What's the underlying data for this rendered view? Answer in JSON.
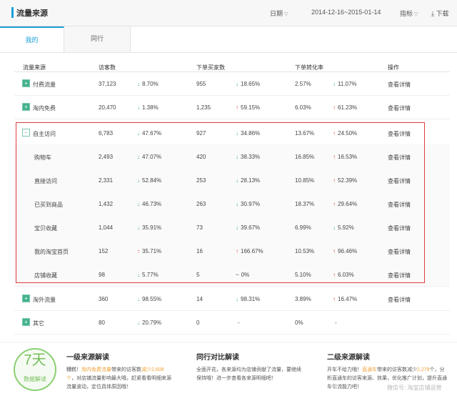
{
  "header": {
    "title": "流量来源",
    "date_label": "日期",
    "date_range": "2014-12-16~2015-01-14",
    "metric_label": "指标",
    "download_label": "下载"
  },
  "tabs": [
    {
      "label": "我的"
    },
    {
      "label": "同行"
    }
  ],
  "table": {
    "columns": [
      "流量来源",
      "访客数",
      "下单买家数",
      "下单转化率",
      "操作"
    ],
    "rows": [
      {
        "name": "付费流量",
        "visitors": "37,123",
        "visitors_change": "8.70%",
        "visitors_dir": "down",
        "buyers": "955",
        "buyers_change": "18.65%",
        "buyers_dir": "down",
        "rate": "2.57%",
        "rate_change": "11.07%",
        "rate_dir": "down",
        "action": "查看详情"
      },
      {
        "name": "淘内免费",
        "visitors": "20,470",
        "visitors_change": "1.38%",
        "visitors_dir": "down",
        "buyers": "1,235",
        "buyers_change": "59.15%",
        "buyers_dir": "up",
        "rate": "6.03%",
        "rate_change": "61.23%",
        "rate_dir": "up",
        "action": "查看详情"
      },
      {
        "name": "自主访问",
        "visitors": "6,783",
        "visitors_change": "47.67%",
        "visitors_dir": "down",
        "buyers": "927",
        "buyers_change": "34.86%",
        "buyers_dir": "down",
        "rate": "13.67%",
        "rate_change": "24.50%",
        "rate_dir": "up",
        "action": "查看详情"
      },
      {
        "name": "购物车",
        "visitors": "2,493",
        "visitors_change": "47.07%",
        "visitors_dir": "down",
        "buyers": "420",
        "buyers_change": "38.33%",
        "buyers_dir": "down",
        "rate": "16.85%",
        "rate_change": "16.53%",
        "rate_dir": "up",
        "action": "查看详情"
      },
      {
        "name": "直接访问",
        "visitors": "2,331",
        "visitors_change": "52.84%",
        "visitors_dir": "down",
        "buyers": "253",
        "buyers_change": "28.13%",
        "buyers_dir": "down",
        "rate": "10.85%",
        "rate_change": "52.39%",
        "rate_dir": "up",
        "action": "查看详情"
      },
      {
        "name": "已买到商品",
        "visitors": "1,432",
        "visitors_change": "46.73%",
        "visitors_dir": "down",
        "buyers": "263",
        "buyers_change": "30.97%",
        "buyers_dir": "down",
        "rate": "18.37%",
        "rate_change": "29.64%",
        "rate_dir": "up",
        "action": "查看详情"
      },
      {
        "name": "宝贝收藏",
        "visitors": "1,044",
        "visitors_change": "35.91%",
        "visitors_dir": "down",
        "buyers": "73",
        "buyers_change": "39.67%",
        "buyers_dir": "down",
        "rate": "6.99%",
        "rate_change": "5.92%",
        "rate_dir": "down",
        "action": "查看详情"
      },
      {
        "name": "我的淘宝首页",
        "visitors": "152",
        "visitors_change": "35.71%",
        "visitors_dir": "up",
        "buyers": "16",
        "buyers_change": "166.67%",
        "buyers_dir": "up",
        "rate": "10.53%",
        "rate_change": "96.46%",
        "rate_dir": "up",
        "action": "查看详情"
      },
      {
        "name": "店铺收藏",
        "visitors": "98",
        "visitors_change": "5.77%",
        "visitors_dir": "down",
        "buyers": "5",
        "buyers_change": "0%",
        "buyers_dir": "flat",
        "rate": "5.10%",
        "rate_change": "6.03%",
        "rate_dir": "up",
        "action": "查看详情"
      },
      {
        "name": "淘外流量",
        "visitors": "360",
        "visitors_change": "98.55%",
        "visitors_dir": "down",
        "buyers": "14",
        "buyers_change": "98.31%",
        "buyers_dir": "down",
        "rate": "3.89%",
        "rate_change": "16.47%",
        "rate_dir": "up",
        "action": "查看详情"
      },
      {
        "name": "其它",
        "visitors": "80",
        "visitors_change": "20.79%",
        "visitors_dir": "down",
        "buyers": "0",
        "buyers_change": "-",
        "buyers_dir": "none",
        "rate": "0%",
        "rate_change": "-",
        "rate_dir": "none",
        "action": ""
      }
    ]
  },
  "insights": {
    "badge_number": "7天",
    "badge_text": "数据解读",
    "first_title": "一级来源解读",
    "first_body_1": "糟糕！",
    "first_highlight_1": "淘内免费流量",
    "first_body_2": "带来的访客数",
    "first_highlight_2": "减少2,608个",
    "first_body_3": "，对店铺流量影响最大哦，赶紧看看明细来源流量波动，定位具体原因哦！",
    "peer_title": "同行对比解读",
    "peer_body": "全面开花，各来源均为店铺贡献了流量，要继续保持哦！进一步查看各来源明细吧！",
    "second_title": "二级来源解读",
    "second_body_1": "开车不给力哦！",
    "second_highlight_1": "直通车",
    "second_body_2": "带来的访客数减少",
    "second_highlight_2": "2,278",
    "second_body_3": "个，分析直通车的访客来源、效果，优化推广计划，提升直通车引流能力吧！",
    "watermark": "微信号: 淘宝店铺运营"
  }
}
